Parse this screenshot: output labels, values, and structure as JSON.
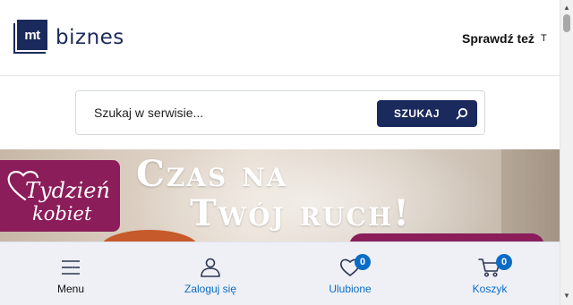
{
  "header": {
    "logo_mark": "mt",
    "logo_text": "biznes",
    "check_also": "Sprawdź też",
    "check_also_extra": "T"
  },
  "search": {
    "placeholder": "Szukaj w serwisie...",
    "button_label": "SZUKAJ"
  },
  "banner": {
    "badge_line1": "Tydzień",
    "badge_line2": "kobiet",
    "headline_line1": "Czas na",
    "headline_line2": "Twój ruch!"
  },
  "bottom_nav": {
    "items": [
      {
        "label": "Menu",
        "icon": "menu-icon"
      },
      {
        "label": "Zaloguj się",
        "icon": "user-icon"
      },
      {
        "label": "Ulubione",
        "icon": "heart-icon",
        "count": "0"
      },
      {
        "label": "Koszyk",
        "icon": "cart-icon",
        "count": "0"
      }
    ]
  },
  "scrollbar": {
    "up_arrow": "▲",
    "down_arrow": "▼"
  },
  "colors": {
    "brand_navy": "#1b2a5c",
    "accent_blue": "#0a6cc4",
    "banner_magenta": "#8a1d5a",
    "nav_bg": "#eef0f6"
  }
}
